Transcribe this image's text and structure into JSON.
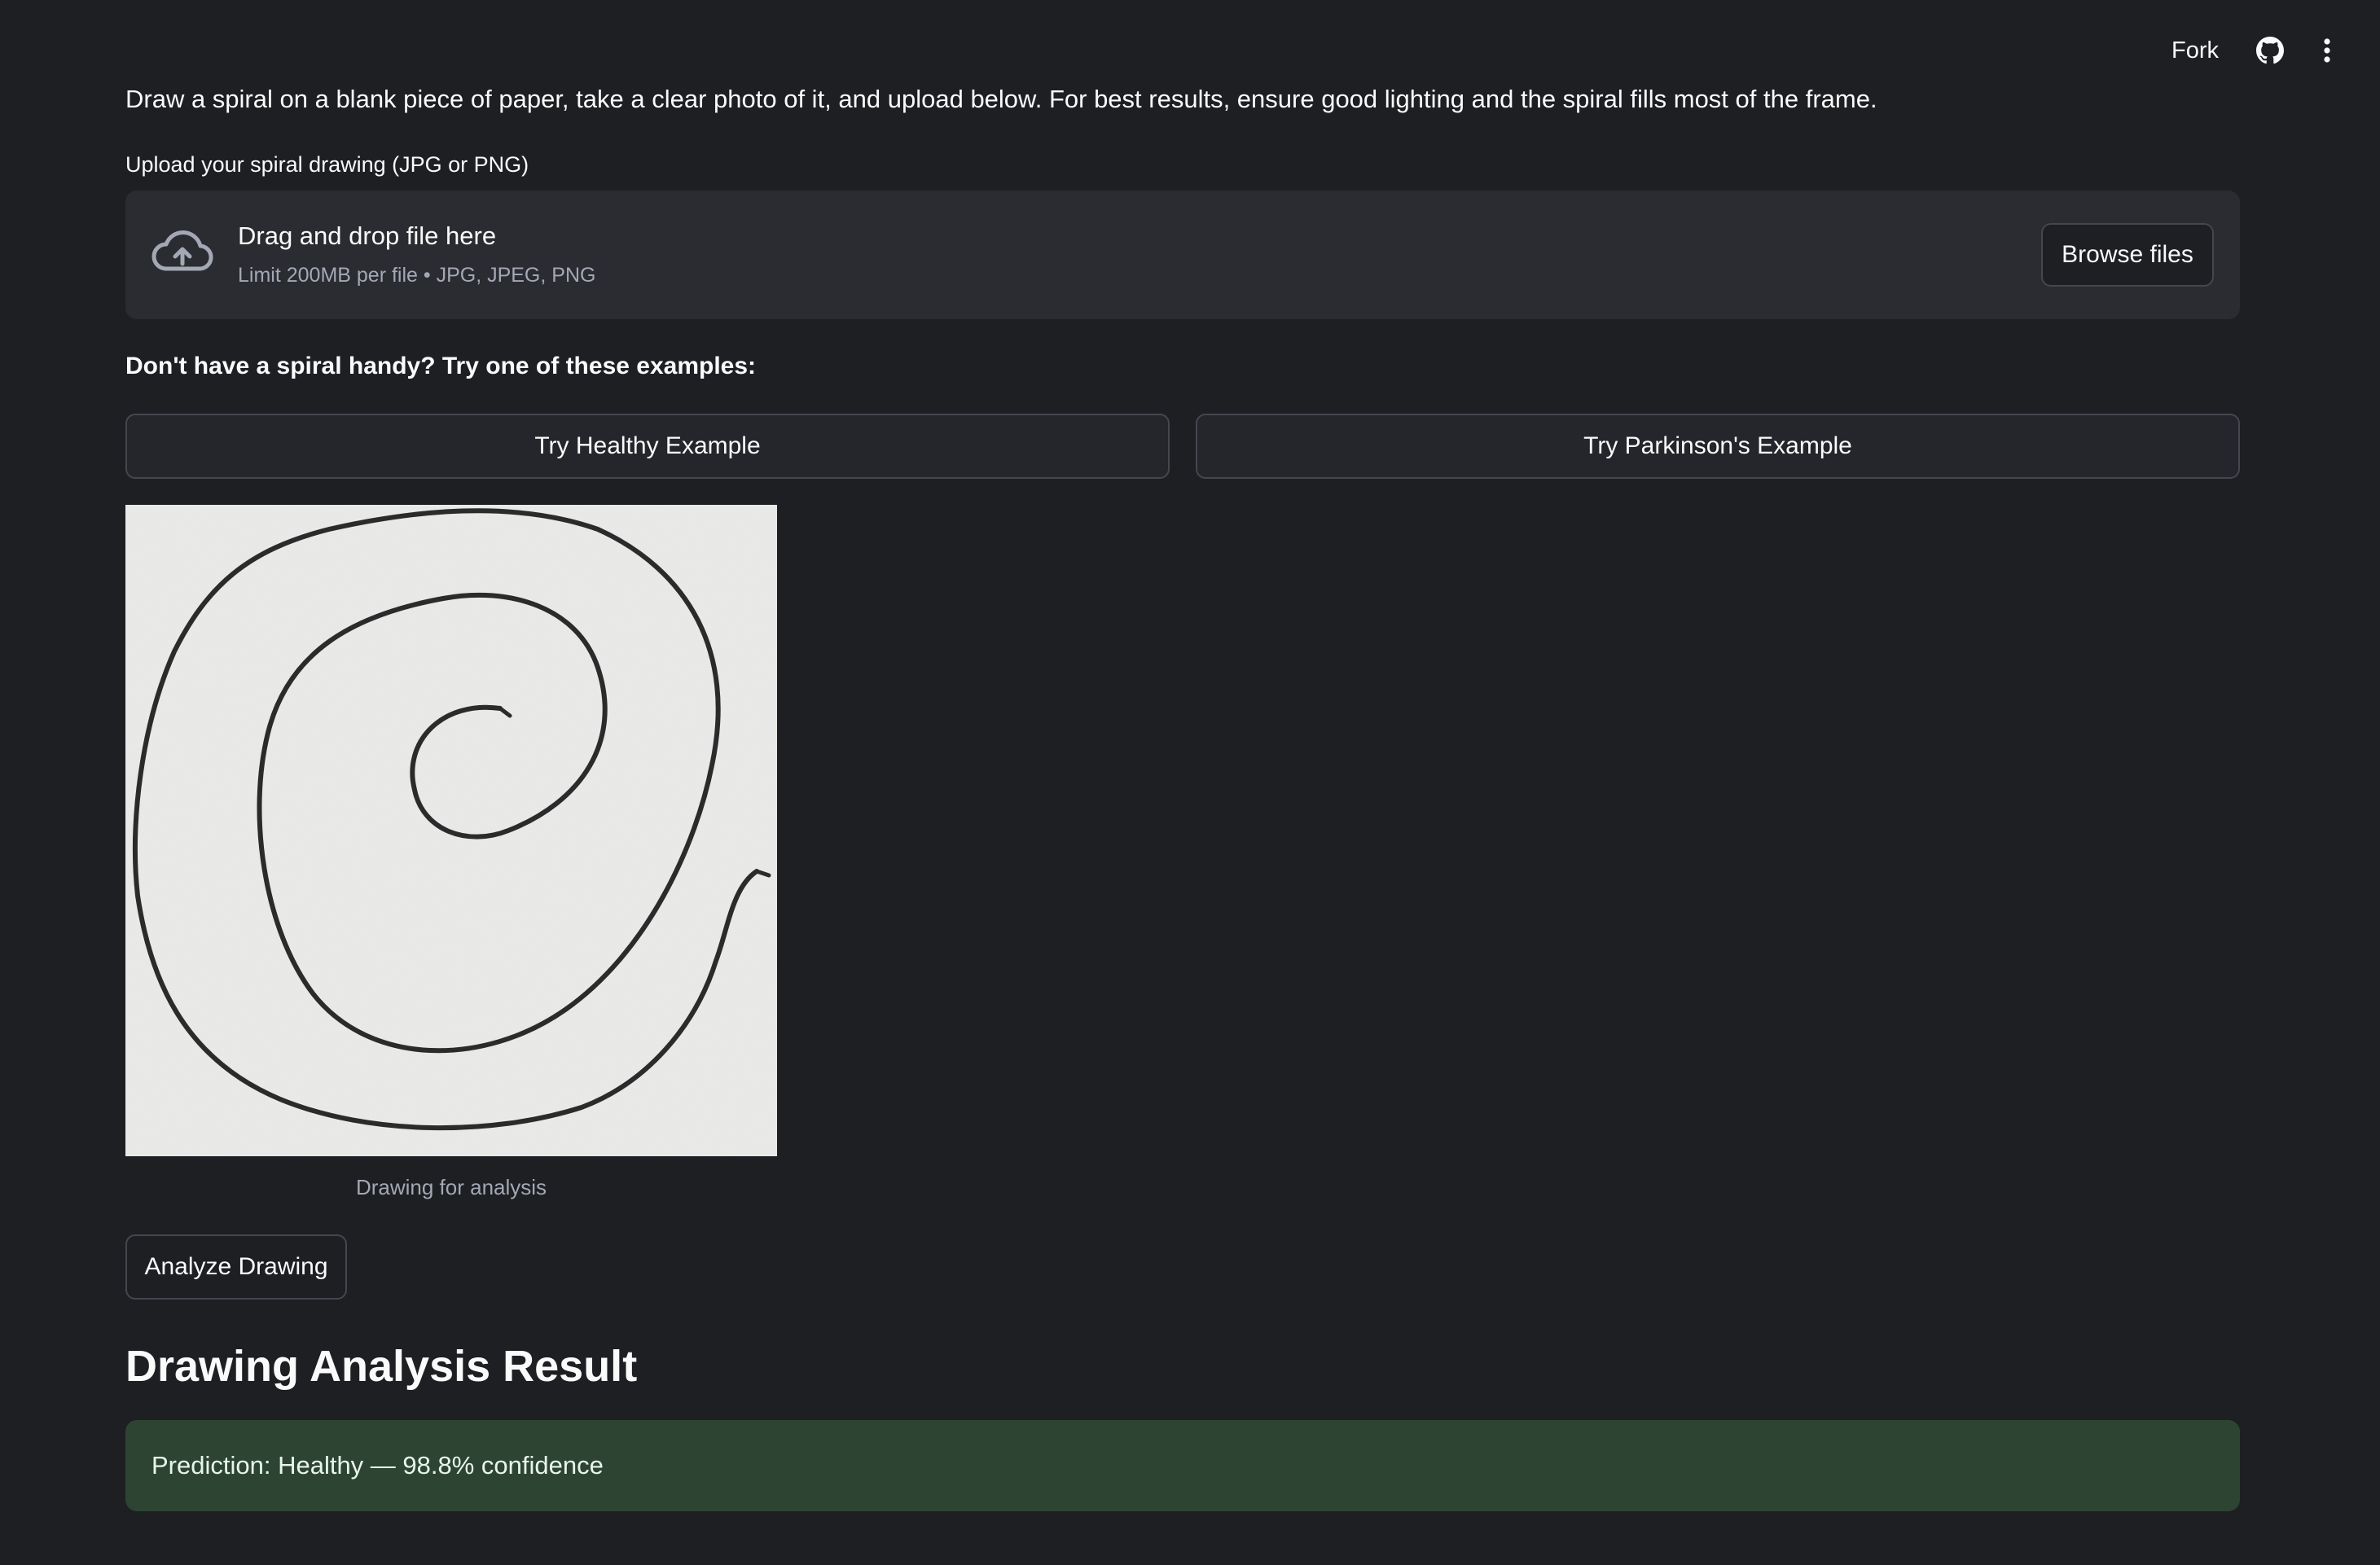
{
  "toolbar": {
    "fork_label": "Fork",
    "github_icon": "github-icon",
    "menu_icon": "kebab-menu-icon"
  },
  "intro_text": "Draw a spiral on a blank piece of paper, take a clear photo of it, and upload below. For best results, ensure good lighting and the spiral fills most of the frame.",
  "uploader": {
    "label": "Upload your spiral drawing (JPG or PNG)",
    "icon": "cloud-upload-icon",
    "title": "Drag and drop file here",
    "subtitle": "Limit 200MB per file • JPG, JPEG, PNG",
    "browse_label": "Browse files"
  },
  "examples": {
    "heading": "Don't have a spiral handy? Try one of these examples:",
    "healthy_label": "Try Healthy Example",
    "parkinsons_label": "Try Parkinson's Example"
  },
  "preview": {
    "caption": "Drawing for analysis"
  },
  "analyze_label": "Analyze Drawing",
  "result": {
    "title": "Drawing Analysis Result",
    "prediction": "Prediction: Healthy — 98.8% confidence"
  },
  "colors": {
    "background": "#1d1f23",
    "dropzone": "#2a2c31",
    "border": "#44474e",
    "success_bg": "#2e4433",
    "muted_text": "#a3a8b4"
  }
}
